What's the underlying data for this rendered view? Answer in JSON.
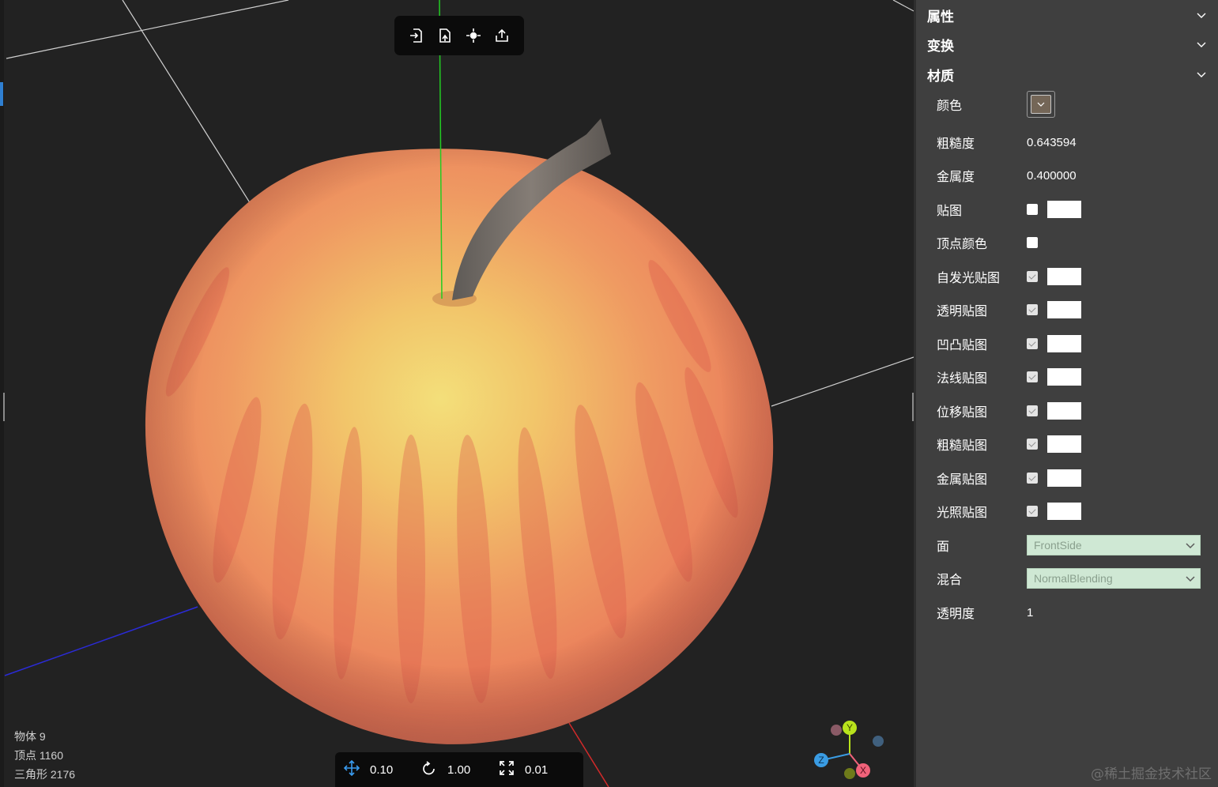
{
  "toolbar_top": {
    "buttons": [
      {
        "name": "import-icon"
      },
      {
        "name": "open-file-icon"
      },
      {
        "name": "locate-icon"
      },
      {
        "name": "export-icon"
      }
    ]
  },
  "toolbar_bottom": {
    "translate_snap": "0.10",
    "rotate_snap": "1.00",
    "scale_snap": "0.01"
  },
  "stats": {
    "objects": "物体 9",
    "vertices": "顶点 1160",
    "triangles": "三角形 2176"
  },
  "gizmo": {
    "y_label": "Y",
    "z_label": "Z",
    "x_label": "X",
    "colors": {
      "x": "#f0627a",
      "y": "#b9e31c",
      "z": "#3a9ce3"
    }
  },
  "panel": {
    "sections": {
      "properties": "属性",
      "transform": "变换",
      "material": "材质"
    },
    "material": {
      "color_label": "颜色",
      "color_value": "#746657",
      "roughness_label": "粗糙度",
      "roughness_value": "0.643594",
      "metalness_label": "金属度",
      "metalness_value": "0.400000",
      "map_label": "贴图",
      "vertex_colors_label": "顶点颜色",
      "emissive_map_label": "自发光贴图",
      "alpha_map_label": "透明贴图",
      "bump_map_label": "凹凸贴图",
      "normal_map_label": "法线贴图",
      "displacement_map_label": "位移贴图",
      "roughness_map_label": "粗糙贴图",
      "metalness_map_label": "金属贴图",
      "light_map_label": "光照贴图",
      "side_label": "面",
      "side_value": "FrontSide",
      "blending_label": "混合",
      "blending_value": "NormalBlending",
      "opacity_label": "透明度",
      "opacity_value": "1"
    }
  },
  "watermark": "@稀土掘金技术社区",
  "colors": {
    "viewport_bg": "#222222",
    "panel_bg": "#3f3f3f",
    "select_bg": "#cfe8d4",
    "grid_line": "#d0d0d0",
    "axis_y": "#22cc22",
    "axis_z": "#2b2bd6",
    "axis_x": "#d22a2a"
  }
}
